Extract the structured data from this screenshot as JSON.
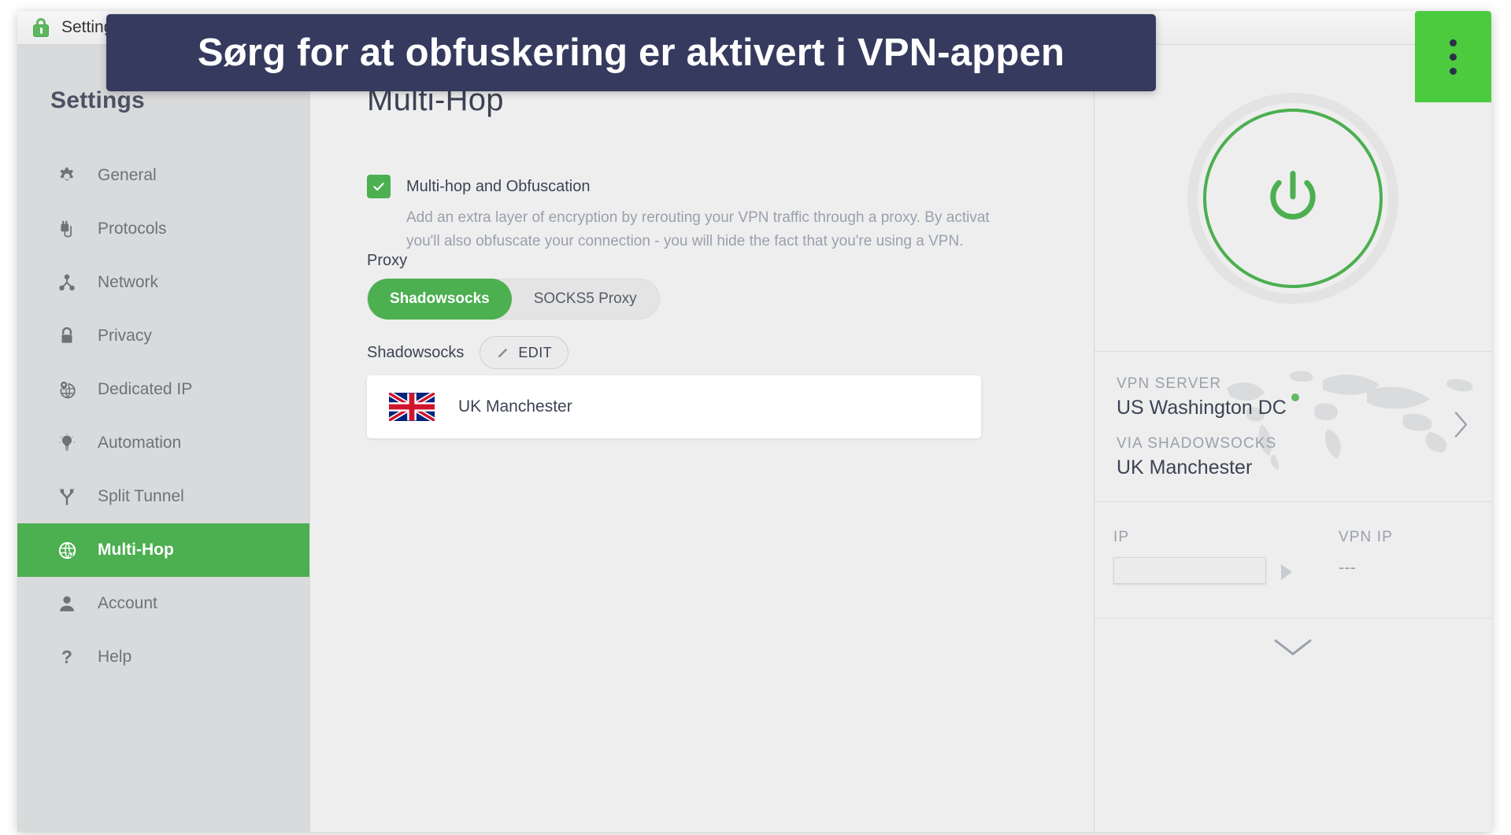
{
  "window": {
    "titlebar": {
      "icon": "lock-icon",
      "title": "Settings - Priv"
    }
  },
  "banner": {
    "text": "Sørg for at obfuskering er aktivert i VPN-appen",
    "background": "#353a5e",
    "text_color": "#ffffff"
  },
  "menu_button": {
    "icon": "kebab-menu-icon",
    "background": "#4ccb3f"
  },
  "sidebar": {
    "title": "Settings",
    "items": [
      {
        "label": "General",
        "icon": "gear-icon",
        "active": false
      },
      {
        "label": "Protocols",
        "icon": "plug-icon",
        "active": false
      },
      {
        "label": "Network",
        "icon": "network-nodes-icon",
        "active": false
      },
      {
        "label": "Privacy",
        "icon": "lock-icon",
        "active": false
      },
      {
        "label": "Dedicated IP",
        "icon": "globe-pin-icon",
        "active": false
      },
      {
        "label": "Automation",
        "icon": "lightbulb-icon",
        "active": false
      },
      {
        "label": "Split Tunnel",
        "icon": "split-arrow-icon",
        "active": false
      },
      {
        "label": "Multi-Hop",
        "icon": "globe-arrow-icon",
        "active": true
      },
      {
        "label": "Account",
        "icon": "person-icon",
        "active": false
      },
      {
        "label": "Help",
        "icon": "question-mark-icon",
        "active": false
      }
    ],
    "active_color": "#4caf50"
  },
  "main": {
    "page_title": "Multi-Hop",
    "option": {
      "label": "Multi-hop and Obfuscation",
      "checked": true,
      "checkbox_color": "#4caf50",
      "description_line1": "Add an extra layer of encryption by rerouting your VPN traffic through a proxy. By activat",
      "description_line2": "you'll also obfuscate your connection - you will hide the fact that you're using a VPN."
    },
    "proxy": {
      "label": "Proxy",
      "options": [
        {
          "label": "Shadowsocks",
          "active": true
        },
        {
          "label": "SOCKS5 Proxy",
          "active": false
        }
      ]
    },
    "shadowsocks": {
      "label": "Shadowsocks",
      "edit_button": "EDIT",
      "edit_icon": "pencil-icon"
    },
    "server_card": {
      "flag": "uk-flag-icon",
      "name": "UK Manchester"
    }
  },
  "status_panel": {
    "power_button": {
      "icon": "power-icon",
      "color": "#4caf50"
    },
    "server": {
      "kicker_1": "VPN SERVER",
      "value_1": "US Washington DC",
      "kicker_2": "VIA SHADOWSOCKS",
      "value_2": "UK Manchester",
      "chevron": "chevron-right-icon"
    },
    "ip": {
      "label_left": "IP",
      "value_left": "",
      "arrow": "arrow-right-icon",
      "label_right": "VPN IP",
      "value_right": "---"
    },
    "collapse_icon": "chevron-down-icon"
  }
}
